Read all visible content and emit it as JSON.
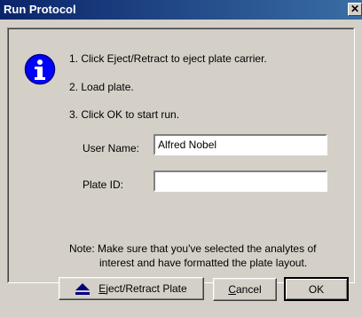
{
  "window": {
    "title": "Run Protocol",
    "close_glyph": "✕"
  },
  "instructions": {
    "step1": "1. Click Eject/Retract to eject plate carrier.",
    "step2": "2. Load plate.",
    "step3": "3. Click OK to start run."
  },
  "form": {
    "user_name_label": "User Name:",
    "user_name_value": "Alfred Nobel",
    "plate_id_label": "Plate ID:",
    "plate_id_value": ""
  },
  "note": {
    "line1": "Note: Make sure that you've selected the analytes of",
    "line2": "interest and have formatted the plate layout."
  },
  "buttons": {
    "eject_mnemonic": "E",
    "eject_rest": "ject/Retract Plate",
    "cancel_mnemonic": "C",
    "cancel_rest": "ancel",
    "ok_label": "OK"
  },
  "icons": {
    "info": "info-icon",
    "eject": "eject-icon"
  },
  "colors": {
    "title_gradient_start": "#0a246a",
    "title_gradient_end": "#3a6ea5",
    "info_blue": "#0000ff",
    "dialog_face": "#d4d0c8"
  }
}
